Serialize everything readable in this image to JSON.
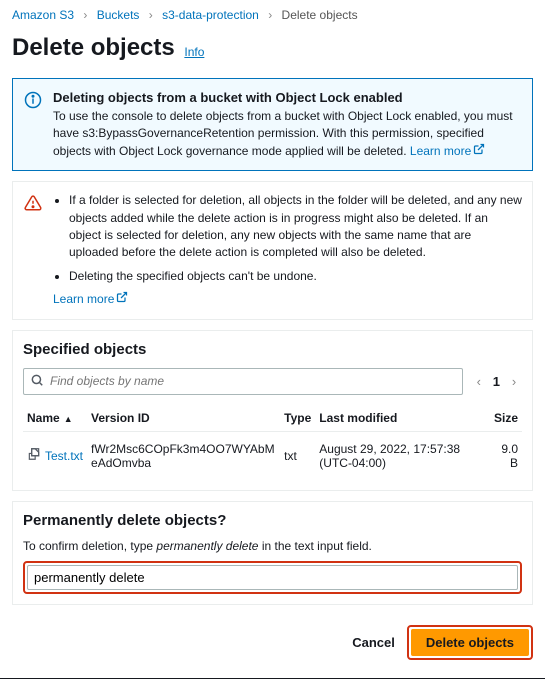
{
  "breadcrumb": {
    "s3": "Amazon S3",
    "buckets": "Buckets",
    "bucket_name": "s3-data-protection",
    "current": "Delete objects"
  },
  "header": {
    "title": "Delete objects",
    "info": "Info"
  },
  "object_lock_alert": {
    "title": "Deleting objects from a bucket with Object Lock enabled",
    "body": "To use the console to delete objects from a bucket with Object Lock enabled, you must have s3:BypassGovernanceRetention permission. With this permission, specified objects with Object Lock governance mode applied will be deleted.",
    "learn_more": "Learn more"
  },
  "warning_alert": {
    "bullets": [
      "If a folder is selected for deletion, all objects in the folder will be deleted, and any new objects added while the delete action is in progress might also be deleted. If an object is selected for deletion, any new objects with the same name that are uploaded before the delete action is completed will also be deleted.",
      "Deleting the specified objects can't be undone."
    ],
    "learn_more": "Learn more"
  },
  "specified": {
    "title": "Specified objects",
    "search_placeholder": "Find objects by name",
    "page": "1",
    "columns": {
      "name": "Name",
      "version": "Version ID",
      "type": "Type",
      "last_modified": "Last modified",
      "size": "Size"
    },
    "rows": [
      {
        "name": "Test.txt",
        "version": "fWr2Msc6COpFk3m4OO7WYAbMeAdOmvba",
        "type": "txt",
        "last_modified": "August 29, 2022, 17:57:38 (UTC-04:00)",
        "size": "9.0 B"
      }
    ]
  },
  "confirm": {
    "title": "Permanently delete objects?",
    "prompt_pre": "To confirm deletion, type ",
    "prompt_italic": "permanently delete",
    "prompt_post": " in the text input field.",
    "value": "permanently delete"
  },
  "footer": {
    "cancel": "Cancel",
    "delete": "Delete objects"
  }
}
